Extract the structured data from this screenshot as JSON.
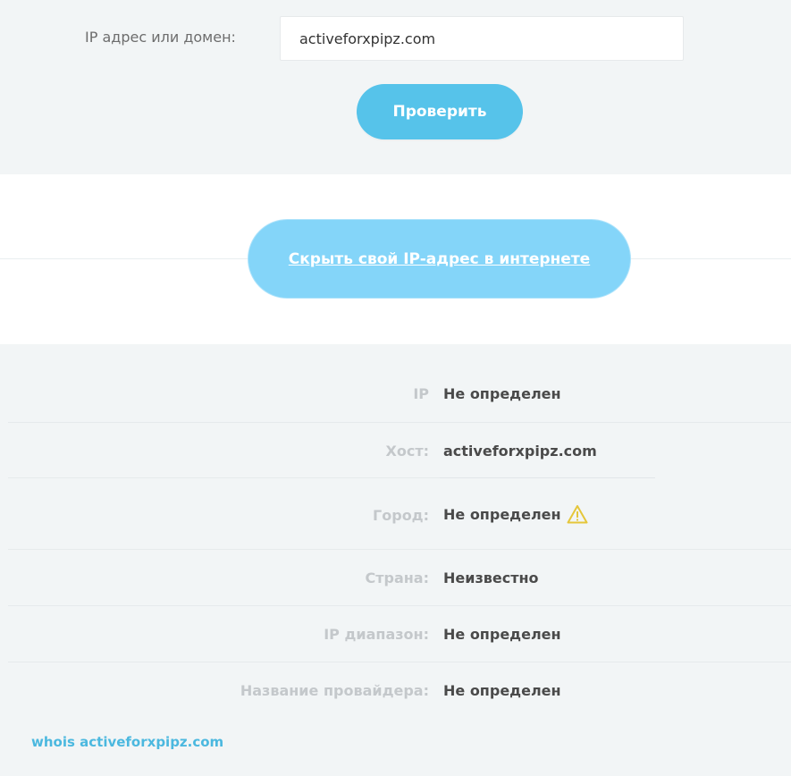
{
  "search": {
    "label": "IP адрес или домен:",
    "value": "activeforxpipz.com"
  },
  "check_button": {
    "label": "Проверить"
  },
  "hide_ip": {
    "label": "Скрыть свой IP-адрес в интернете"
  },
  "results": {
    "rows": [
      {
        "label": "IP",
        "value": "Не определен"
      },
      {
        "label": "Хост:",
        "value": "activeforxpipz.com"
      },
      {
        "label": "Город:",
        "value": "Не определен",
        "icon": "warning-icon"
      },
      {
        "label": "Страна:",
        "value": "Неизвестно"
      },
      {
        "label": "IP диапазон:",
        "value": "Не определен"
      },
      {
        "label": "Название провайдера:",
        "value": "Не определен"
      }
    ]
  },
  "whois": {
    "label": "whois activeforxpipz.com"
  },
  "colors": {
    "accent": "#56c3ea",
    "hide_button": "#84d5f9",
    "warning": "#e5c63a",
    "link": "#4bb8df"
  }
}
